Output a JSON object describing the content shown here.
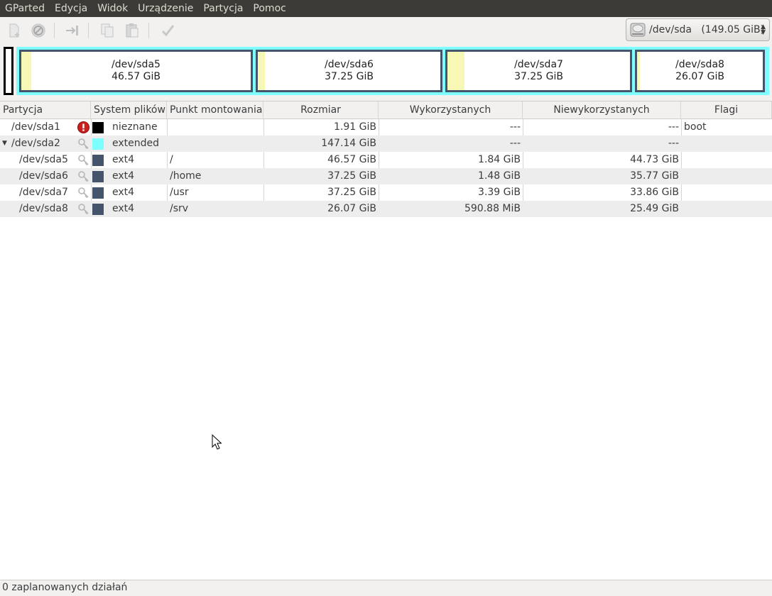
{
  "menubar": {
    "items": [
      "GParted",
      "Edycja",
      "Widok",
      "Urządzenie",
      "Partycja",
      "Pomoc"
    ]
  },
  "toolbar": {
    "icons": [
      "new-partition-icon",
      "delete-partition-icon",
      "resize-move-icon",
      "copy-icon",
      "paste-icon",
      "apply-icon"
    ]
  },
  "device": {
    "label": "/dev/sda   (149.05 GiB)"
  },
  "disk_visual": {
    "partitions": [
      {
        "name": "/dev/sda5",
        "size": "46.57 GiB"
      },
      {
        "name": "/dev/sda6",
        "size": "37.25 GiB"
      },
      {
        "name": "/dev/sda7",
        "size": "37.25 GiB"
      },
      {
        "name": "/dev/sda8",
        "size": "26.07 GiB"
      }
    ],
    "colors": {
      "extended": "#7effff",
      "ext4": "#44546a",
      "unknown": "#000000",
      "used": "#f7f7b6"
    }
  },
  "table": {
    "headers": [
      "Partycja",
      "System plików",
      "Punkt montowania",
      "Rozmiar",
      "Wykorzystanych",
      "Niewykorzystanych",
      "Flagi"
    ],
    "rows": [
      {
        "partition": "/dev/sda1",
        "fs": "nieznane",
        "mount": "",
        "size": "1.91 GiB",
        "used": "---",
        "unused": "---",
        "flags": "boot"
      },
      {
        "partition": "/dev/sda2",
        "fs": "extended",
        "mount": "",
        "size": "147.14 GiB",
        "used": "---",
        "unused": "---",
        "flags": ""
      },
      {
        "partition": "/dev/sda5",
        "fs": "ext4",
        "mount": "/",
        "size": "46.57 GiB",
        "used": "1.84 GiB",
        "unused": "44.73 GiB",
        "flags": ""
      },
      {
        "partition": "/dev/sda6",
        "fs": "ext4",
        "mount": "/home",
        "size": "37.25 GiB",
        "used": "1.48 GiB",
        "unused": "35.77 GiB",
        "flags": ""
      },
      {
        "partition": "/dev/sda7",
        "fs": "ext4",
        "mount": "/usr",
        "size": "37.25 GiB",
        "used": "3.39 GiB",
        "unused": "33.86 GiB",
        "flags": ""
      },
      {
        "partition": "/dev/sda8",
        "fs": "ext4",
        "mount": "/srv",
        "size": "26.07 GiB",
        "used": "590.88 MiB",
        "unused": "25.49 GiB",
        "flags": ""
      }
    ]
  },
  "status": {
    "text": "0 zaplanowanych działań"
  }
}
